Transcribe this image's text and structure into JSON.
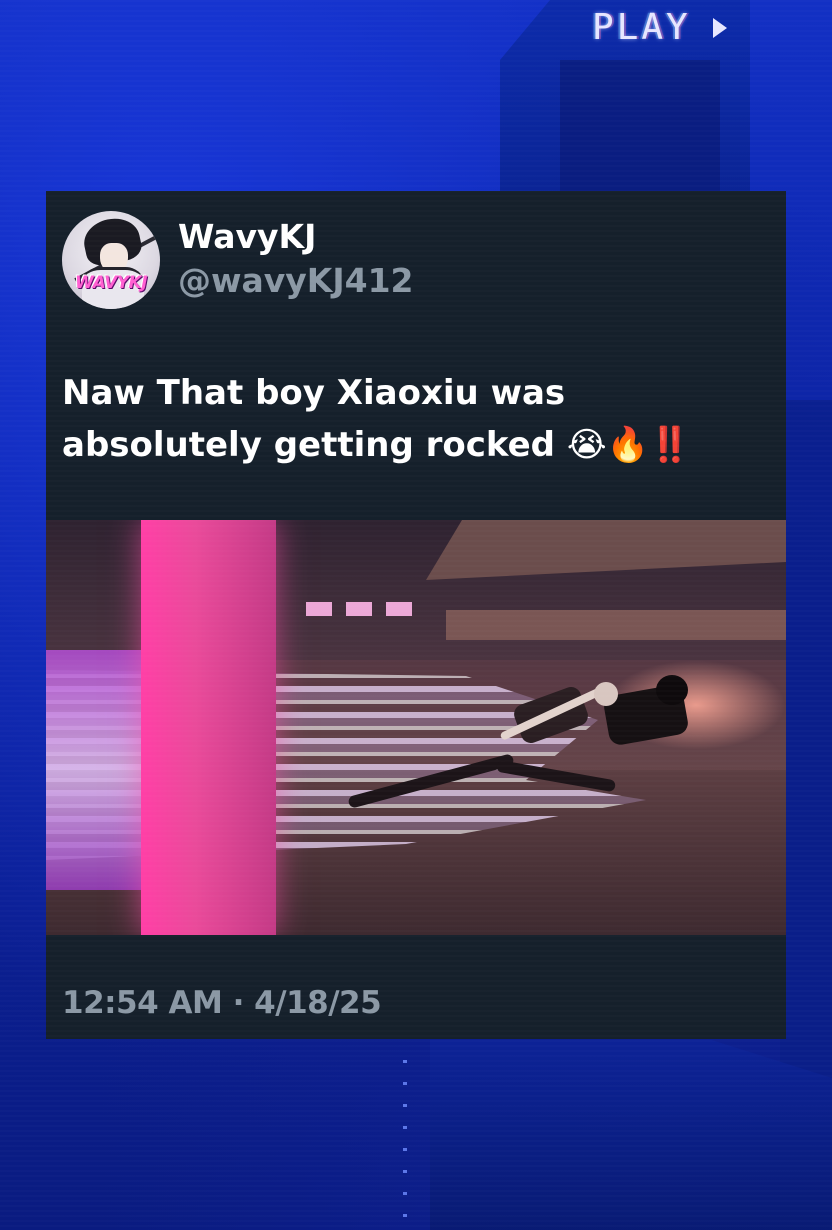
{
  "overlay": {
    "play_label": "PLAY"
  },
  "tweet": {
    "display_name": "WavyKJ",
    "handle": "@wavyKJ412",
    "avatar_logo_text": "WAVYKJ",
    "text": "Naw That boy Xiaoxiu was absolutely getting rocked 😭🔥‼️",
    "timestamp": "12:54 AM · 4/18/25"
  },
  "colors": {
    "card_background": "#15202b",
    "primary_text": "#ffffff",
    "secondary_text": "#8b98a5",
    "page_background": "#1230c4",
    "accent_pink": "#ff3fa6"
  },
  "icons": {
    "play": "play-triangle-icon"
  }
}
